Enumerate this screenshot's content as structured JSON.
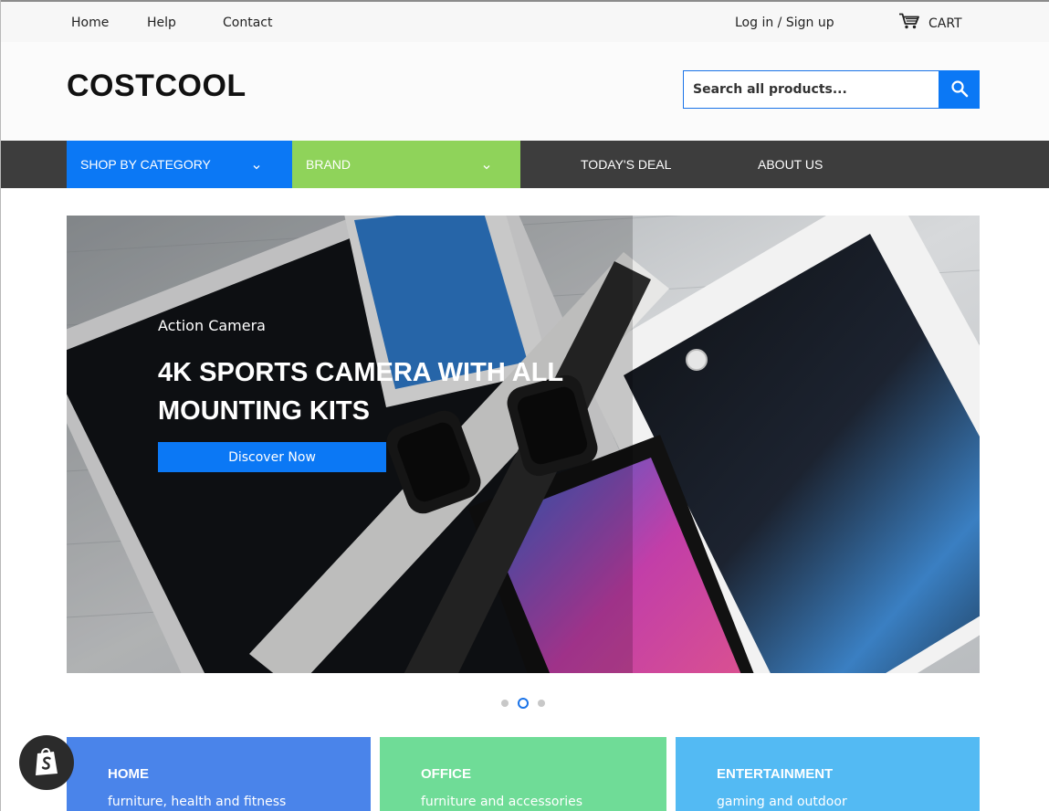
{
  "topbar": {
    "links": {
      "home": "Home",
      "help": "Help",
      "contact": "Contact"
    },
    "login": "Log in / Sign up",
    "cart": "CART"
  },
  "header": {
    "logo": "COSTCOOL",
    "search_placeholder": "Search all products..."
  },
  "nav": {
    "category": "SHOP BY CATEGORY",
    "brand": "BRAND",
    "deal": "TODAY'S DEAL",
    "about": "ABOUT US"
  },
  "hero": {
    "subtitle": "Action Camera",
    "title": "4K SPORTS CAMERA WITH ALL MOUNTING KITS",
    "button": "Discover Now"
  },
  "slider": {
    "count": 3,
    "active_index": 2
  },
  "tiles": [
    {
      "title": "HOME",
      "desc": "furniture, health and fitness"
    },
    {
      "title": "OFFICE",
      "desc": "furniture and accessories"
    },
    {
      "title": "ENTERTAINMENT",
      "desc": "gaming and outdoor"
    }
  ],
  "colors": {
    "primary_blue": "#0b78f5",
    "brand_green": "#8fd35a",
    "nav_dark": "#3d3d3d",
    "tile_home": "#4a84ea",
    "tile_office": "#6fdc97",
    "tile_entertainment": "#53baf3"
  },
  "icons": {
    "cart": "cart-icon",
    "search": "search-icon",
    "chevron": "chevron-down-icon",
    "badge": "shopify-bag-icon"
  }
}
